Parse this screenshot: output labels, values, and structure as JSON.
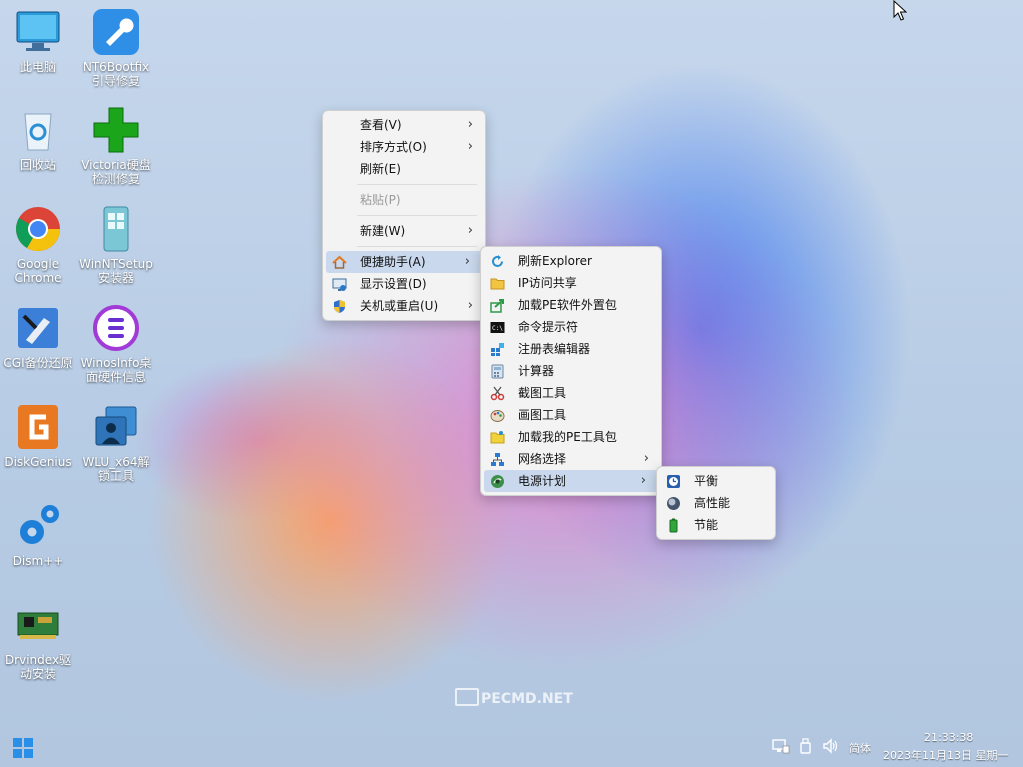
{
  "desktop": {
    "icons": [
      {
        "label": "此电脑",
        "icon": "computer-icon"
      },
      {
        "label": "NT6Bootfix引导修复",
        "icon": "wrench-icon"
      },
      {
        "label": "回收站",
        "icon": "recycle-bin-icon"
      },
      {
        "label": "Victoria硬盘检测修复",
        "icon": "green-cross-icon"
      },
      {
        "label": "Google Chrome",
        "icon": "chrome-icon"
      },
      {
        "label": "WinNTSetup安装器",
        "icon": "winntsetup-icon"
      },
      {
        "label": "CGI备份还原",
        "icon": "cgi-backup-icon"
      },
      {
        "label": "WinosInfo桌面硬件信息",
        "icon": "winosinfo-icon"
      },
      {
        "label": "DiskGenius",
        "icon": "diskgenius-icon"
      },
      {
        "label": "WLU_x64解锁工具",
        "icon": "wlu-icon"
      },
      {
        "label": "Dism++",
        "icon": "gears-icon"
      },
      {
        "label": "Drvindex驱动安装",
        "icon": "circuit-board-icon"
      }
    ],
    "watermark": "PECMD.NET"
  },
  "context_menu": {
    "items": [
      {
        "label": "查看(V)",
        "submenu": true
      },
      {
        "label": "排序方式(O)",
        "submenu": true
      },
      {
        "label": "刷新(E)",
        "submenu": false
      },
      {
        "label": "粘贴(P)",
        "disabled": true
      },
      {
        "label": "新建(W)",
        "submenu": true
      },
      {
        "label": "便捷助手(A)",
        "submenu": true,
        "highlighted": true,
        "icon": "home-icon"
      },
      {
        "label": "显示设置(D)",
        "icon": "display-settings-icon"
      },
      {
        "label": "关机或重启(U)",
        "submenu": true,
        "icon": "shield-icon"
      }
    ]
  },
  "assistant_menu": {
    "items": [
      {
        "label": "刷新Explorer",
        "icon": "refresh-icon"
      },
      {
        "label": "IP访问共享",
        "icon": "folder-icon"
      },
      {
        "label": "加载PE软件外置包",
        "icon": "share-arrow-icon"
      },
      {
        "label": "命令提示符",
        "icon": "cmd-icon"
      },
      {
        "label": "注册表编辑器",
        "icon": "registry-icon"
      },
      {
        "label": "计算器",
        "icon": "calculator-icon"
      },
      {
        "label": "截图工具",
        "icon": "scissors-icon"
      },
      {
        "label": "画图工具",
        "icon": "paint-palette-icon"
      },
      {
        "label": "加载我的PE工具包",
        "icon": "folder-star-icon"
      },
      {
        "label": "网络选择",
        "submenu": true,
        "icon": "network-icon"
      },
      {
        "label": "电源计划",
        "submenu": true,
        "highlighted": true,
        "icon": "power-plan-icon"
      }
    ]
  },
  "power_menu": {
    "items": [
      {
        "label": "平衡",
        "icon": "clock-icon"
      },
      {
        "label": "高性能",
        "icon": "high-performance-icon"
      },
      {
        "label": "节能",
        "icon": "battery-icon"
      }
    ]
  },
  "taskbar": {
    "ime": "简体",
    "time": "21:33:38",
    "date": "2023年11月13日 星期一"
  },
  "chevron": "›"
}
